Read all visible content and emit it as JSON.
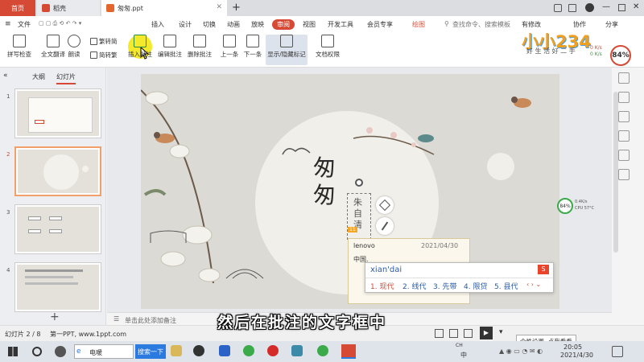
{
  "window_tabs": {
    "home": "首页",
    "docer": "稻壳",
    "doc": "匆匆.ppt"
  },
  "menus": [
    "文件",
    "插入",
    "设计",
    "切换",
    "动画",
    "放映",
    "审阅",
    "视图",
    "开发工具",
    "会员专享"
  ],
  "active_menu": "审阅",
  "menu_right": {
    "tool_tab": "绘图",
    "search_placeholder": "查找命令、搜索模板",
    "changes": "有修改",
    "collab": "协作",
    "share": "分享"
  },
  "toolbar": {
    "spell": "拼写检查",
    "translate": "全文翻译",
    "read": "朗读",
    "to_trad": "繁转简",
    "to_simp": "简转繁",
    "insert_comment": "插入批注",
    "edit_comment": "编辑批注",
    "delete_comment": "删除批注",
    "prev": "上一条",
    "next": "下一条",
    "show_hide": "显示/隐藏标记",
    "permission": "文档权限"
  },
  "watermark": {
    "logo": "小小234",
    "slogan": "好 生 活 好 二 手",
    "speed_up": "0 K/s",
    "speed_down": "0 K/s",
    "percent": "84%"
  },
  "left_panel": {
    "tab_outline": "大纲",
    "tab_slides": "幻灯片",
    "slide_numbers": [
      "1",
      "2",
      "3",
      "4"
    ],
    "add": "+"
  },
  "slide": {
    "title": "匆匆",
    "author": "朱自清",
    "comment_marker": "11"
  },
  "comment": {
    "author": "lenovo",
    "date": "2021/04/30",
    "text": "中国."
  },
  "ime": {
    "pinyin": "xian'dai",
    "candidates": [
      "1. 现代",
      "2. 线代",
      "3. 先带",
      "4. 限贷",
      "5. 县代"
    ]
  },
  "cpu_widget": {
    "percent": "84%",
    "speed": "0.4K/s",
    "cpu": "CPU 57°C"
  },
  "notes_placeholder": "单击此处添加备注",
  "subtitle": "然后在批注的文字框中",
  "status": {
    "slide": "幻灯片 2 / 8",
    "theme": "第一PPT, www.1ppt.com",
    "tooltip": "个性设置, 点我看看"
  },
  "taskbar": {
    "browser": "电暖",
    "search_btn": "搜索一下",
    "ime_ch": "中",
    "time": "20:05",
    "date": "2021/4/30"
  }
}
